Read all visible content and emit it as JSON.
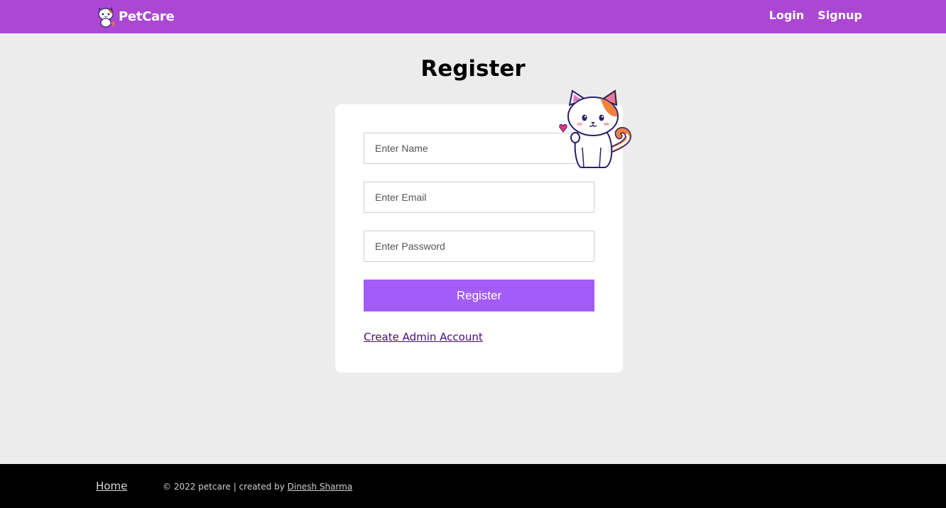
{
  "navbar": {
    "brand": "PetCare",
    "links": [
      {
        "label": "Login"
      },
      {
        "label": "Signup"
      }
    ],
    "color": "#ab47d3"
  },
  "page": {
    "title": "Register"
  },
  "form": {
    "name_placeholder": "Enter Name",
    "email_placeholder": "Enter Email",
    "password_placeholder": "Enter Password",
    "submit_label": "Register",
    "admin_link": "Create Admin Account",
    "button_color": "#a35cf7"
  },
  "footer": {
    "home": "Home",
    "copyright": "© 2022 petcare | created by",
    "author": "Dinesh Sharma"
  }
}
